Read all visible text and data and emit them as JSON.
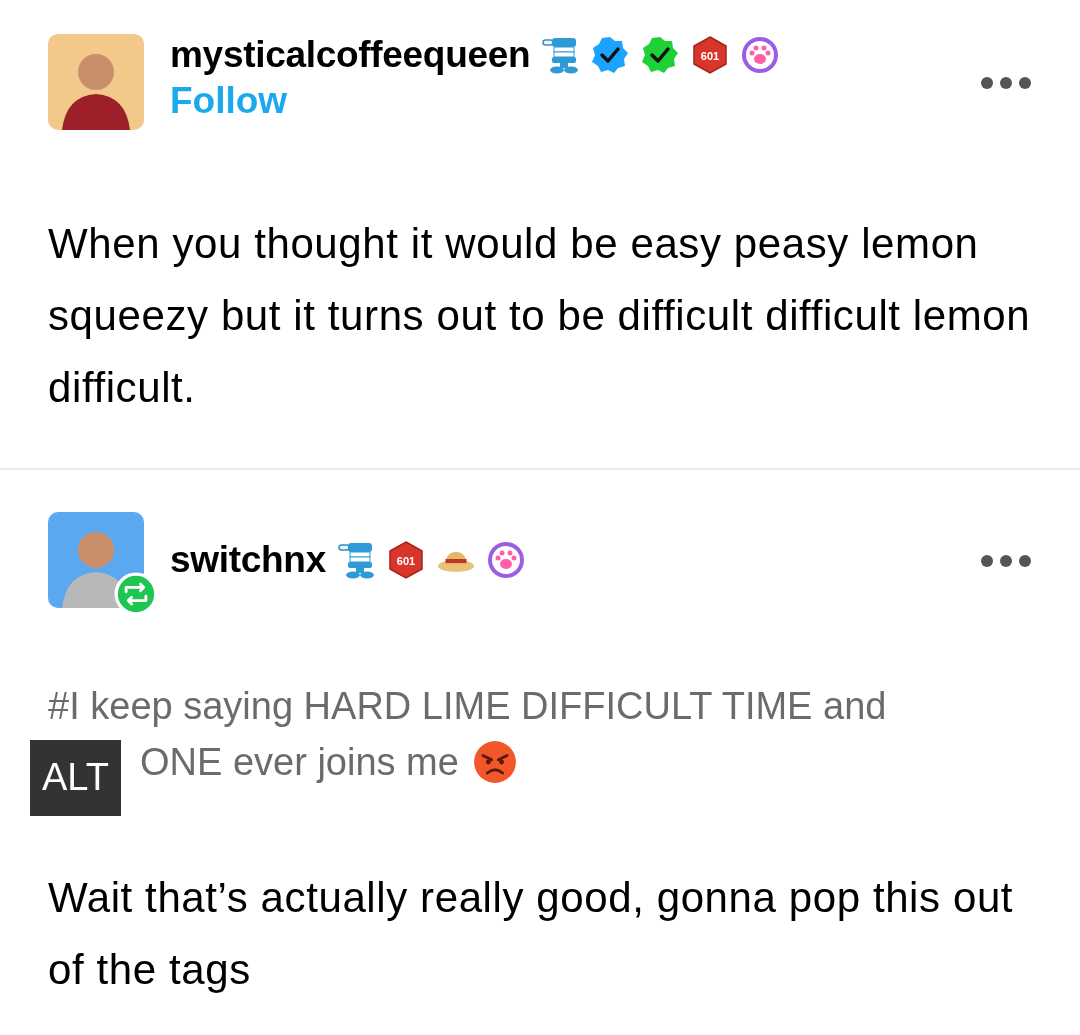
{
  "posts": [
    {
      "username": "mysticalcoffeequeen",
      "follow": "Follow",
      "reblog": false,
      "badges": [
        {
          "kind": "teeth"
        },
        {
          "kind": "verified",
          "color": "#1aa3ff"
        },
        {
          "kind": "verified",
          "color": "#1ed136"
        },
        {
          "kind": "hexagon",
          "text": "601"
        },
        {
          "kind": "paw"
        }
      ],
      "paragraphs": [
        "When you thought it would be easy peasy lemon squeezy but it turns out to be difficult difficult lemon difficult."
      ]
    },
    {
      "username": "switchnx",
      "reblog": true,
      "badges": [
        {
          "kind": "teeth"
        },
        {
          "kind": "hexagon",
          "text": "601"
        },
        {
          "kind": "hat"
        },
        {
          "kind": "paw"
        }
      ],
      "image": {
        "lines": [
          "#I keep saying HARD LIME DIFFICULT TIME and",
          "ONE ever joins me"
        ],
        "alt": "ALT"
      },
      "paragraphs": [
        "Wait that’s actually really good, gonna pop this out of the tags"
      ]
    }
  ]
}
